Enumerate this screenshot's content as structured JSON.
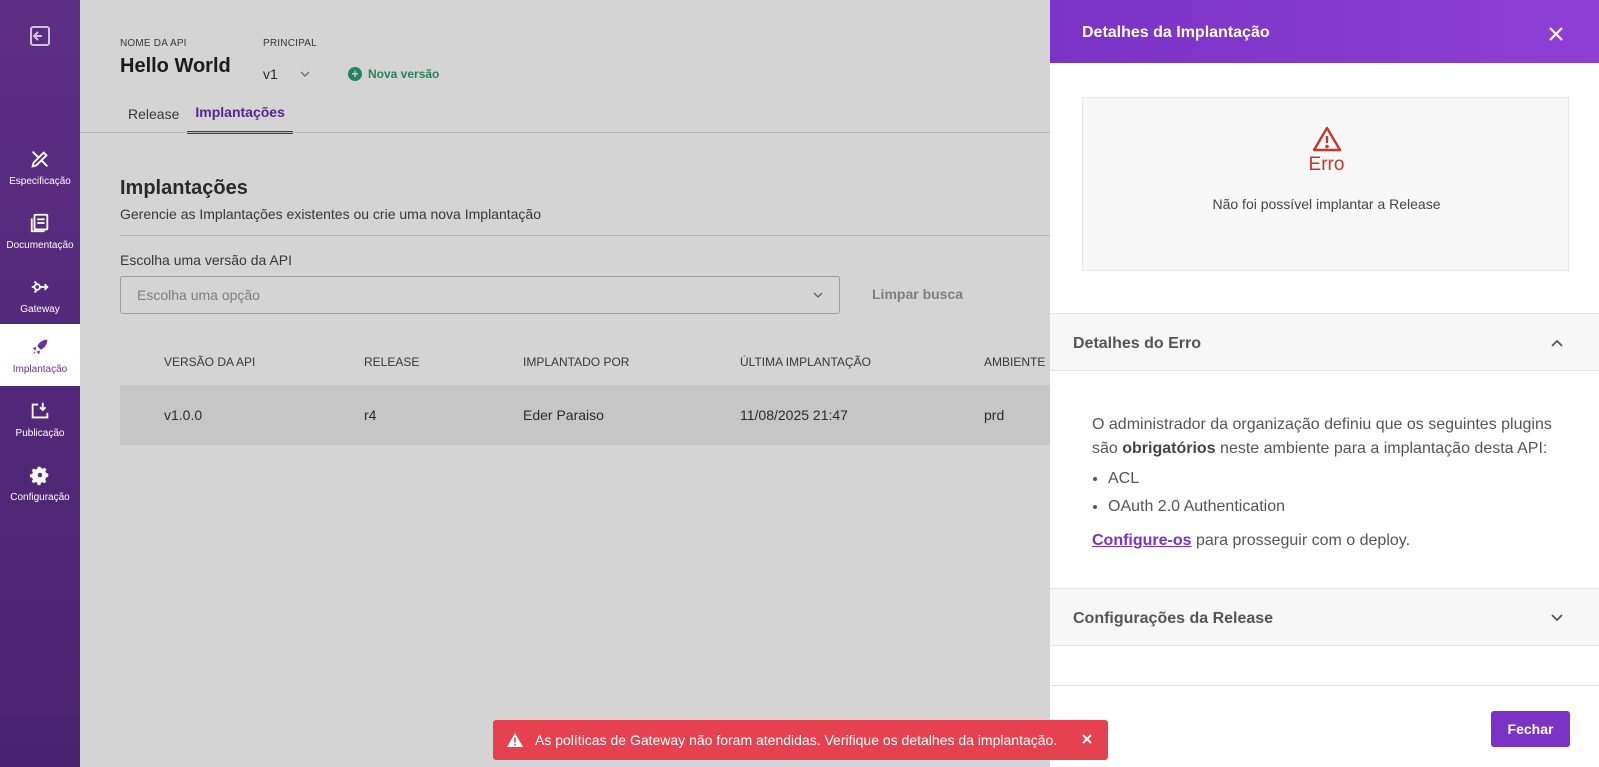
{
  "sidebar": {
    "items": [
      {
        "label": "Especificação",
        "icon": "pen-ruler-icon"
      },
      {
        "label": "Documentação",
        "icon": "book-icon"
      },
      {
        "label": "Gateway",
        "icon": "gateway-icon"
      },
      {
        "label": "Implantação",
        "icon": "rocket-icon",
        "active": true
      },
      {
        "label": "Publicação",
        "icon": "publish-icon"
      },
      {
        "label": "Configuração",
        "icon": "gear-icon"
      }
    ]
  },
  "header": {
    "api_name_label": "NOME DA API",
    "api_name": "Hello World",
    "principal_label": "PRINCIPAL",
    "version": "v1",
    "new_version": "Nova versão"
  },
  "tabs": [
    {
      "label": "Release"
    },
    {
      "label": "Implantações",
      "active": true
    }
  ],
  "main": {
    "title": "Implantações",
    "subtitle": "Gerencie as Implantações existentes ou crie uma nova Implantação",
    "choose_label": "Escolha uma versão da API",
    "select_placeholder": "Escolha uma opção",
    "clear_search": "Limpar busca"
  },
  "table": {
    "headers": [
      "VERSÃO DA API",
      "RELEASE",
      "IMPLANTADO POR",
      "ÚLTIMA IMPLANTAÇÃO",
      "AMBIENTE"
    ],
    "rows": [
      {
        "version": "v1.0.0",
        "release": "r4",
        "deployed_by": "Eder Paraiso",
        "last_deploy": "11/08/2025 21:47",
        "environment": "prd"
      }
    ]
  },
  "drawer": {
    "title": "Detalhes da Implantação",
    "error_title": "Erro",
    "error_message": "Não foi possível implantar a Release",
    "error_details_title": "Detalhes do Erro",
    "error_text_pre": "O administrador da organização definiu que os seguintes plugins são ",
    "error_text_bold": "obrigatórios",
    "error_text_post": " neste ambiente para a implantação desta API:",
    "plugins": [
      "ACL",
      "OAuth 2.0 Authentication"
    ],
    "config_link": "Configure-os",
    "config_text": " para prosseguir com o deploy.",
    "release_config_title": "Configurações da Release",
    "close_button": "Fechar"
  },
  "toast": {
    "message": "As políticas de Gateway não foram atendidas. Verifique os detalhes da implantação."
  },
  "colors": {
    "primary": "#7a33c4",
    "sidebar": "#5c2e84",
    "error": "#c0392b",
    "toast": "#e5414f",
    "accent_green": "#2f9d74"
  }
}
